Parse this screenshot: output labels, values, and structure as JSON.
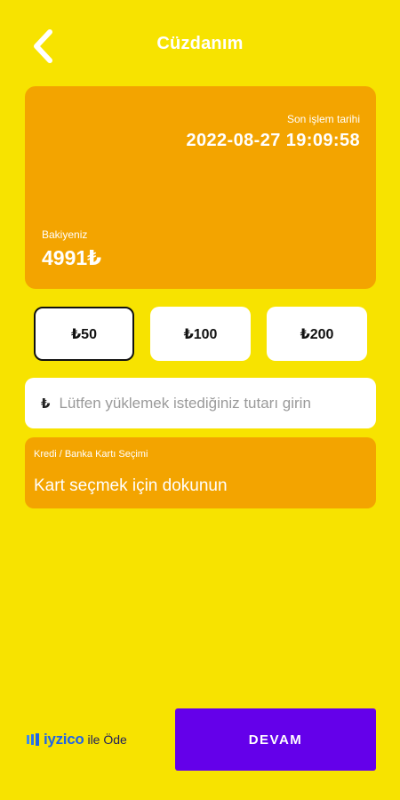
{
  "header": {
    "title": "Cüzdanım",
    "back_icon": "chevron-left-icon"
  },
  "wallet": {
    "last_transaction_label": "Son işlem tarihi",
    "last_transaction_value": "2022-08-27 19:09:58",
    "balance_label": "Bakiyeniz",
    "balance_value": "4991₺"
  },
  "amount_options": [
    {
      "label": "₺50",
      "selected": true
    },
    {
      "label": "₺100",
      "selected": false
    },
    {
      "label": "₺200",
      "selected": false
    }
  ],
  "custom_amount": {
    "currency_symbol": "₺",
    "value": "",
    "placeholder": "Lütfen yüklemek istediğiniz tutarı girin"
  },
  "card_selection": {
    "label": "Kredi / Banka Kartı Seçimi",
    "value": "Kart seçmek için dokunun"
  },
  "footer": {
    "payment_brand": "iyzico",
    "payment_suffix": "ile Öde",
    "continue_label": "DEVAM"
  },
  "colors": {
    "background": "#F7E300",
    "card_orange": "#F3A400",
    "continue_purple": "#6400EA",
    "iyzico_blue": "#1E64E6"
  }
}
